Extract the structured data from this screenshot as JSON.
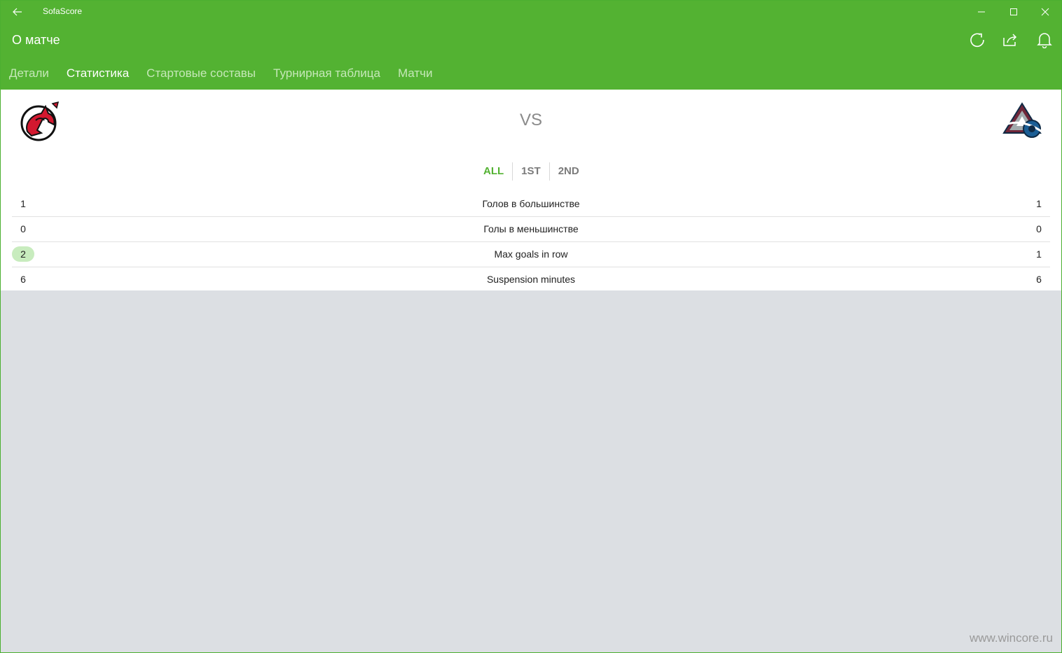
{
  "window": {
    "app_title": "SofaScore"
  },
  "header": {
    "page_title": "О матче",
    "tabs": [
      {
        "label": "Детали",
        "active": false
      },
      {
        "label": "Статистика",
        "active": true
      },
      {
        "label": "Стартовые составы",
        "active": false
      },
      {
        "label": "Турнирная таблица",
        "active": false
      },
      {
        "label": "Матчи",
        "active": false
      }
    ]
  },
  "match": {
    "vs_label": "VS"
  },
  "periods": [
    {
      "label": "ALL",
      "active": true
    },
    {
      "label": "1ST",
      "active": false
    },
    {
      "label": "2ND",
      "active": false
    }
  ],
  "stats": [
    {
      "home": "1",
      "name": "Голов в большинстве",
      "away": "1"
    },
    {
      "home": "0",
      "name": "Голы в меньшинстве",
      "away": "0"
    },
    {
      "home": "2",
      "name": "Max goals in row",
      "away": "1",
      "home_highlight": true
    },
    {
      "home": "6",
      "name": "Suspension minutes",
      "away": "6"
    }
  ],
  "watermark": "www.wincore.ru",
  "colors": {
    "accent": "#53b232",
    "tab_inactive": "#c5e8b8",
    "highlight": "#c8ecbe",
    "background": "#dcdfe3"
  },
  "icons": {
    "back": "back-arrow-icon",
    "minimize": "minimize-icon",
    "maximize": "maximize-icon",
    "close": "close-icon",
    "refresh": "refresh-icon",
    "share": "share-icon",
    "notifications": "bell-icon",
    "home_team": "new-jersey-devils-logo",
    "away_team": "colorado-avalanche-logo"
  }
}
